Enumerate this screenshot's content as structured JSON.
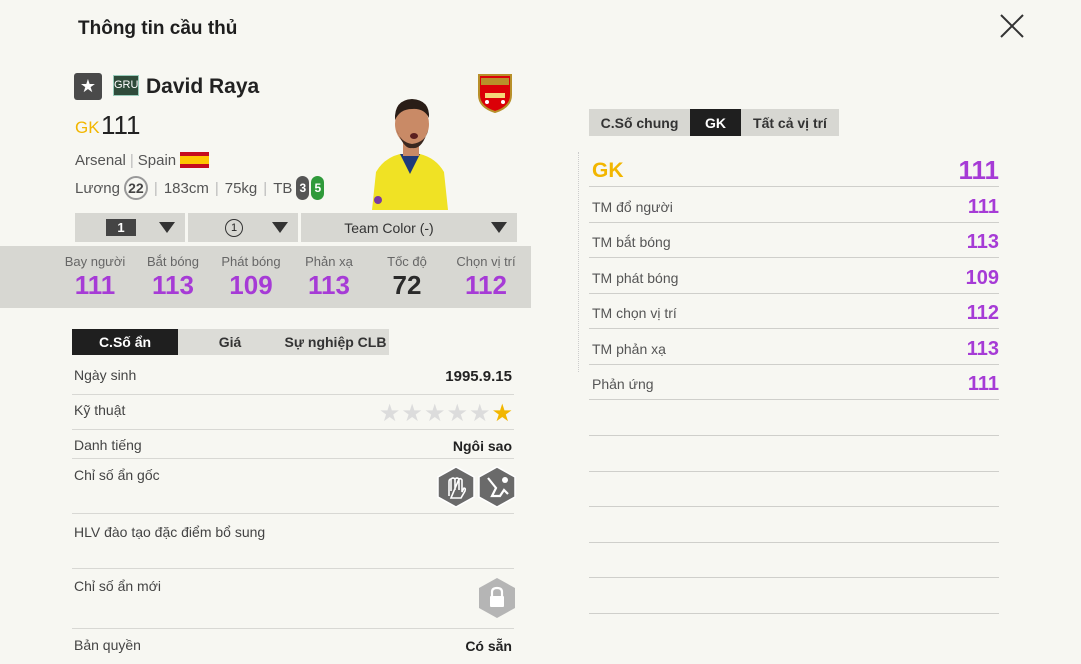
{
  "header": {
    "title": "Thông tin cầu thủ"
  },
  "player": {
    "season_badge": "GRU",
    "name": "David Raya",
    "position": "GK",
    "ovr": "111",
    "club": "Arsenal",
    "nation": "Spain",
    "salary_label": "Lương",
    "salary": "22",
    "height": "183cm",
    "weight": "75kg",
    "body_type": "TB",
    "weak_foot_left": "3",
    "weak_foot_right": "5"
  },
  "selectors": {
    "level": "1",
    "team_color_level": "1",
    "team_color": "Team Color (-)"
  },
  "stats": [
    {
      "label": "Bay người",
      "value": "111"
    },
    {
      "label": "Bắt bóng",
      "value": "113"
    },
    {
      "label": "Phát bóng",
      "value": "109"
    },
    {
      "label": "Phản xạ",
      "value": "113"
    },
    {
      "label": "Tốc độ",
      "value": "72"
    },
    {
      "label": "Chọn vị trí",
      "value": "112"
    }
  ],
  "left_tabs": [
    "C.Số ẩn",
    "Giá",
    "Sự nghiệp CLB"
  ],
  "details": {
    "birth_label": "Ngày sinh",
    "birth": "1995.9.15",
    "skill_label": "Kỹ thuật",
    "skill_stars": 1,
    "skill_max": 6,
    "fame_label": "Danh tiếng",
    "fame": "Ngôi sao",
    "orig_traits_label": "Chỉ số ẩn gốc",
    "coach_label": "HLV đào tạo đặc điểm bổ sung",
    "new_traits_label": "Chỉ số ẩn mới",
    "license_label": "Bản quyền",
    "license": "Có sẵn"
  },
  "right_tabs": [
    "C.Số chung",
    "GK",
    "Tất cả vị trí"
  ],
  "position_table": {
    "head": {
      "label": "GK",
      "value": "111"
    },
    "rows": [
      {
        "label": "TM đổ người",
        "value": "111"
      },
      {
        "label": "TM bắt bóng",
        "value": "113"
      },
      {
        "label": "TM phát bóng",
        "value": "109"
      },
      {
        "label": "TM chọn vị trí",
        "value": "112"
      },
      {
        "label": "TM phản xạ",
        "value": "113"
      },
      {
        "label": "Phản ứng",
        "value": "111"
      }
    ]
  },
  "colors": {
    "accent_purple": "#a63bd6",
    "gold": "#f2b600",
    "dark": "#1f1f1f"
  },
  "icons": [
    "close-icon",
    "star-icon",
    "club-crest-icon",
    "chevron-down-icon",
    "glove-hex-icon",
    "kick-hex-icon",
    "lock-hex-icon"
  ]
}
